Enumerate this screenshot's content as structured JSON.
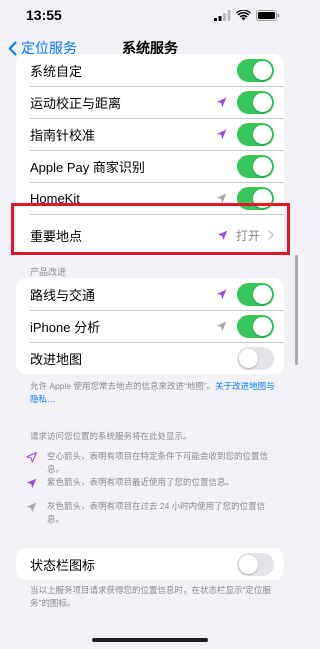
{
  "status": {
    "time": "13:55"
  },
  "nav": {
    "back_label": "定位服务",
    "title": "系统服务"
  },
  "group1": [
    {
      "label": "系统自定",
      "arrow": "none",
      "control": "toggle-on"
    },
    {
      "label": "运动校正与距离",
      "arrow": "purple",
      "control": "toggle-on"
    },
    {
      "label": "指南针校准",
      "arrow": "purple",
      "control": "toggle-on"
    },
    {
      "label": "Apple Pay 商家识别",
      "arrow": "none",
      "control": "toggle-on"
    },
    {
      "label": "HomeKit",
      "arrow": "gray",
      "control": "toggle-on"
    },
    {
      "label": "重要地点",
      "arrow": "purple",
      "control": "detail",
      "value": "打开"
    }
  ],
  "section2": {
    "header": "产品改进",
    "rows": [
      {
        "label": "路线与交通",
        "arrow": "purple",
        "control": "toggle-on"
      },
      {
        "label": "iPhone 分析",
        "arrow": "gray",
        "control": "toggle-on"
      },
      {
        "label": "改进地图",
        "arrow": "none",
        "control": "toggle-off"
      }
    ],
    "footer_text": "允许 Apple 使用您常去地点的信息来改进“地图”。",
    "footer_link": "关于改进地图与隐私…"
  },
  "legend": {
    "intro": "请求访问您位置的系统服务将在此处显示。",
    "items": [
      {
        "icon": "hollow-arrow-icon",
        "text": "空心箭头，表明有项目在特定条件下可能会收到您的位置信息。"
      },
      {
        "icon": "purple-arrow-icon",
        "text": "紫色箭头，表明有项目最近使用了您的位置信息。"
      },
      {
        "icon": "gray-arrow-icon",
        "text": "灰色箭头，表明有项目在过去 24 小时内使用了您的位置信息。"
      }
    ]
  },
  "status_bar_icon": {
    "label": "状态栏图标",
    "footer": "当以上服务项目请求获得您的位置信息时，在状态栏显示“定位服务”的图标。"
  },
  "colors": {
    "accent": "#007aff",
    "toggle_on": "#34c759",
    "purple_arrow": "#9a4fdc",
    "gray_arrow": "#a6a6ab",
    "highlight": "#e2162b"
  }
}
